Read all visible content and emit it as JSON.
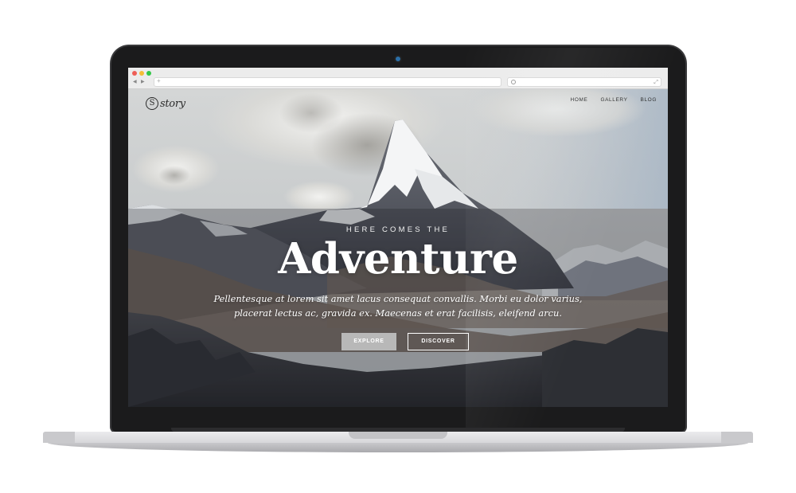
{
  "browser": {
    "back_icon": "◀",
    "forward_icon": "▶",
    "new_tab_icon": "+",
    "expand_icon": "⤢"
  },
  "site": {
    "logo_mark": "S",
    "logo_text": "story",
    "nav": [
      "HOME",
      "GALLERY",
      "BLOG"
    ]
  },
  "hero": {
    "eyebrow": "HERE COMES THE",
    "headline": "Adventure",
    "body": "Pellentesque at lorem sit amet lacus consequat convallis. Morbi eu dolor varius, placerat lectus ac, gravida ex. Maecenas et erat facilisis, eleifend arcu.",
    "buttons": {
      "explore": "EXPLORE",
      "discover": "DISCOVER"
    }
  },
  "colors": {
    "bezel": "#1b1b1c",
    "accent_button": "#b8b8b8",
    "camera": "#2b6fa8"
  }
}
